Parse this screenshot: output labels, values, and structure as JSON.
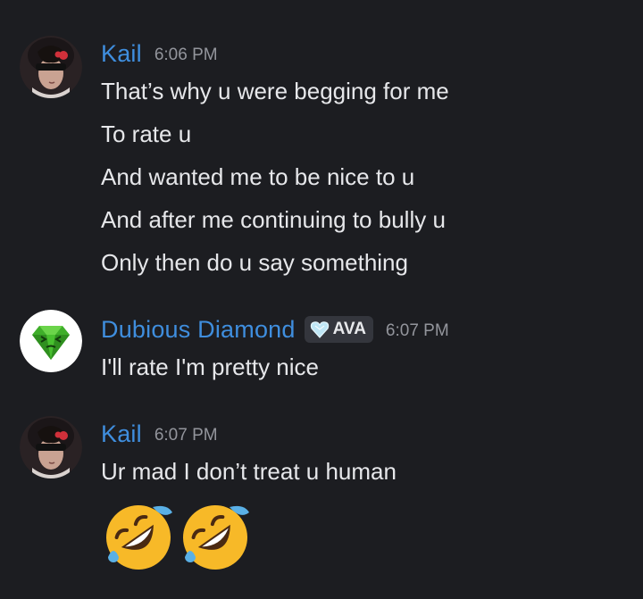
{
  "messages": [
    {
      "author": "Kail",
      "time": "6:06 PM",
      "avatar_icon": "user-avatar-icon",
      "lines": [
        "That’s why u were begging for me",
        "To rate u",
        "And wanted me to be nice to u",
        "And after me continuing to bully u",
        "Only then do u say something"
      ]
    },
    {
      "author": "Dubious Diamond",
      "tag": "AVA",
      "tag_icon": "heart-gem-icon",
      "time": "6:07 PM",
      "avatar_icon": "green-diamond-icon",
      "lines": [
        "I'll rate I'm pretty nice"
      ]
    },
    {
      "author": "Kail",
      "time": "6:07 PM",
      "avatar_icon": "user-avatar-icon",
      "lines": [
        "Ur mad I don’t treat u human"
      ],
      "emojis": [
        "rolling-on-floor-laughing-emoji",
        "rolling-on-floor-laughing-emoji"
      ]
    }
  ],
  "colors": {
    "background": "#1c1d21",
    "username": "#3f8ede",
    "text": "#e6e7ea",
    "timestamp": "#93959c"
  }
}
